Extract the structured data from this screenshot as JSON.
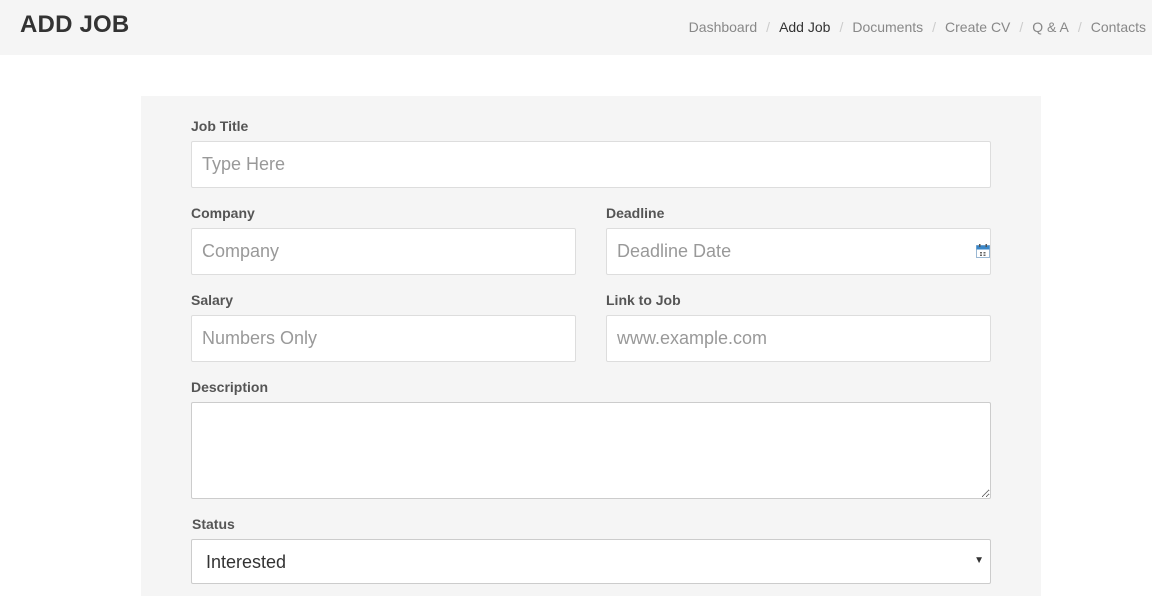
{
  "header": {
    "title": "ADD JOB",
    "breadcrumb": [
      {
        "label": "Dashboard"
      },
      {
        "label": "Add Job"
      },
      {
        "label": "Documents"
      },
      {
        "label": "Create CV"
      },
      {
        "label": "Q & A"
      },
      {
        "label": "Contacts"
      }
    ],
    "separator": "/"
  },
  "form": {
    "job_title": {
      "label": "Job Title",
      "placeholder": "Type Here",
      "value": ""
    },
    "company": {
      "label": "Company",
      "placeholder": "Company",
      "value": ""
    },
    "deadline": {
      "label": "Deadline",
      "placeholder": "Deadline Date",
      "value": "",
      "icon": "calendar-icon"
    },
    "salary": {
      "label": "Salary",
      "placeholder": "Numbers Only",
      "value": ""
    },
    "link": {
      "label": "Link to Job",
      "placeholder": "www.example.com",
      "value": ""
    },
    "description": {
      "label": "Description",
      "value": ""
    },
    "status": {
      "label": "Status",
      "selected": "Interested"
    }
  },
  "colors": {
    "header_bg": "#f5f5f5",
    "panel_bg": "#f5f5f5",
    "breadcrumb_active": "#333333",
    "breadcrumb_inactive": "#888888",
    "calendar_accent": "#3a87c8"
  }
}
